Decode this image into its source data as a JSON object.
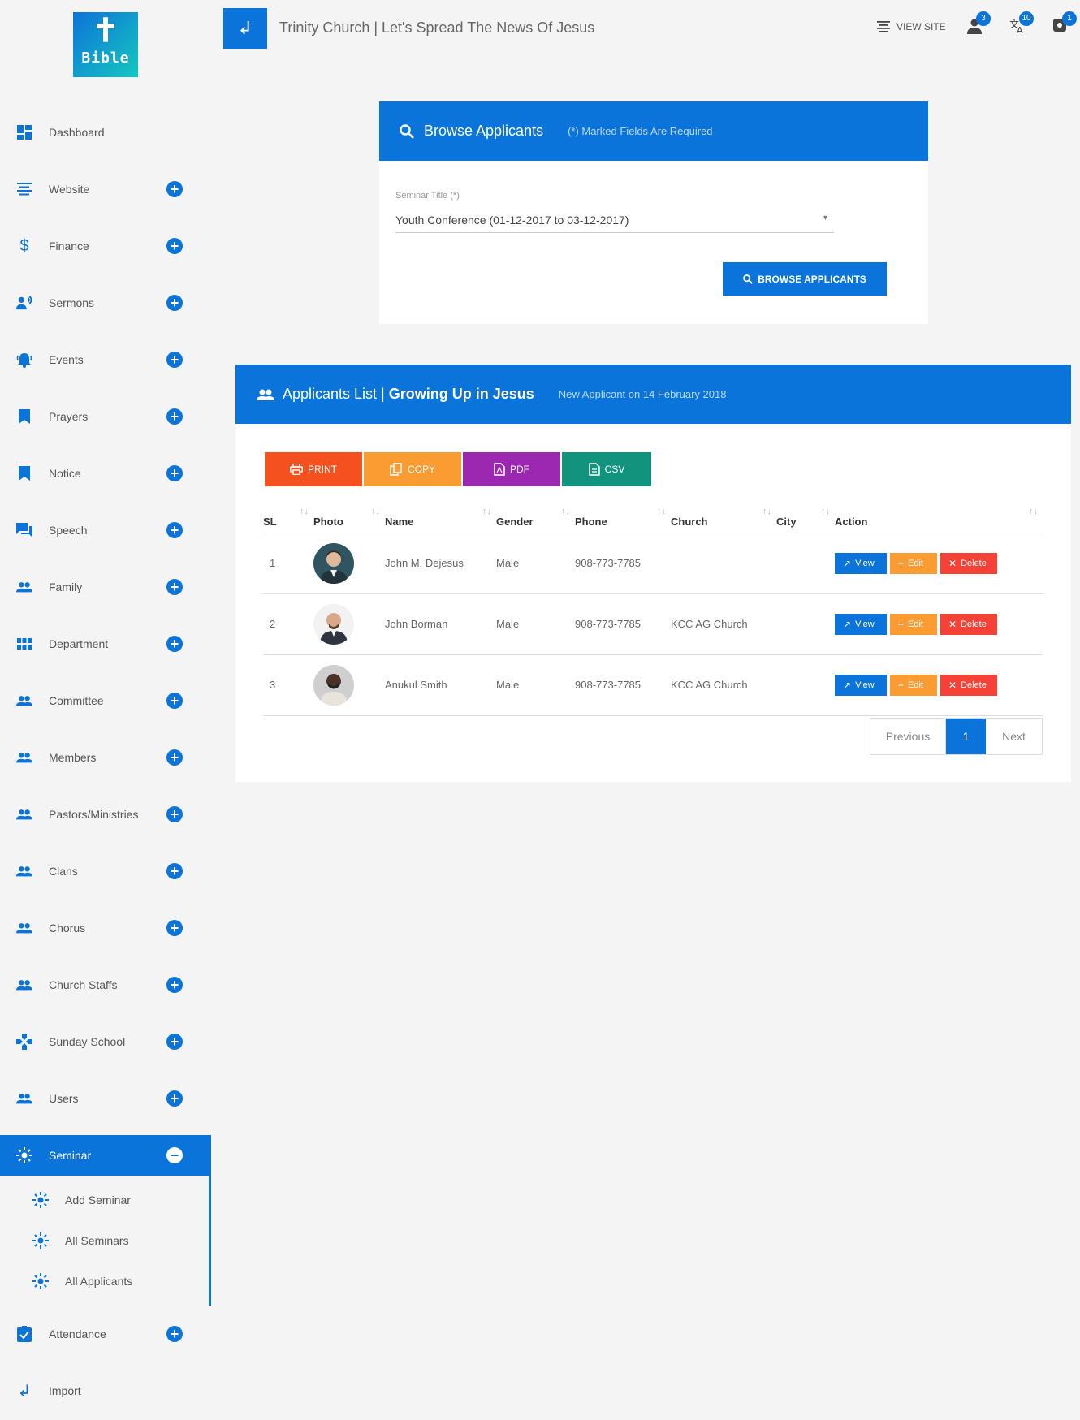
{
  "logo": {
    "text": "Bible"
  },
  "header": {
    "title": "Trinity Church | Let's Spread The News Of Jesus",
    "view_site": "VIEW SITE",
    "badges": {
      "users": "3",
      "translate": "10",
      "settings": "1"
    }
  },
  "sidebar": {
    "items": [
      {
        "label": "Dashboard",
        "icon": "dashboard-icon"
      },
      {
        "label": "Website",
        "icon": "website-icon"
      },
      {
        "label": "Finance",
        "icon": "dollar-icon"
      },
      {
        "label": "Sermons",
        "icon": "sermons-icon"
      },
      {
        "label": "Events",
        "icon": "bell-icon"
      },
      {
        "label": "Prayers",
        "icon": "bookmark-icon"
      },
      {
        "label": "Notice",
        "icon": "bookmark-icon"
      },
      {
        "label": "Speech",
        "icon": "chat-icon"
      },
      {
        "label": "Family",
        "icon": "people-icon"
      },
      {
        "label": "Department",
        "icon": "grid-icon"
      },
      {
        "label": "Committee",
        "icon": "people-icon"
      },
      {
        "label": "Members",
        "icon": "people-icon"
      },
      {
        "label": "Pastors/Ministries",
        "icon": "people-icon"
      },
      {
        "label": "Clans",
        "icon": "people-icon"
      },
      {
        "label": "Chorus",
        "icon": "people-icon"
      },
      {
        "label": "Church Staffs",
        "icon": "people-icon"
      },
      {
        "label": "Sunday School",
        "icon": "gamepad-icon"
      },
      {
        "label": "Users",
        "icon": "people-icon"
      }
    ],
    "active": {
      "label": "Seminar",
      "icon": "seminar-icon"
    },
    "sub_items": [
      {
        "label": "Add Seminar"
      },
      {
        "label": "All Seminars"
      },
      {
        "label": "All Applicants"
      }
    ],
    "after": [
      {
        "label": "Attendance",
        "icon": "clipboard-check-icon"
      },
      {
        "label": "Import",
        "icon": "import-icon"
      }
    ]
  },
  "browse": {
    "title": "Browse Applicants",
    "required_note": "(*) Marked Fields Are Required",
    "field_label": "Seminar Title (*)",
    "selected_value": "Youth Conference (01-12-2017 to 03-12-2017)",
    "button": "BROWSE APPLICANTS"
  },
  "list": {
    "title_prefix": "Applicants List | ",
    "title_bold": "Growing Up in Jesus",
    "subtitle": "New Applicant on 14 February 2018",
    "exports": {
      "print": "PRINT",
      "copy": "COPY",
      "pdf": "PDF",
      "csv": "CSV"
    },
    "columns": [
      "SL",
      "Photo",
      "Name",
      "Gender",
      "Phone",
      "Church",
      "City",
      "Action"
    ],
    "rows": [
      {
        "sl": "1",
        "name": "John M. Dejesus",
        "gender": "Male",
        "phone": "908-773-7785",
        "church": "",
        "city": ""
      },
      {
        "sl": "2",
        "name": "John Borman",
        "gender": "Male",
        "phone": "908-773-7785",
        "church": "KCC AG Church",
        "city": ""
      },
      {
        "sl": "3",
        "name": "Anukul Smith",
        "gender": "Male",
        "phone": "908-773-7785",
        "church": "KCC AG Church",
        "city": ""
      }
    ],
    "actions": {
      "view": "View",
      "edit": "Edit",
      "delete": "Delete"
    },
    "pager": {
      "prev": "Previous",
      "page": "1",
      "next": "Next"
    }
  },
  "colors": {
    "primary": "#0a74da",
    "print": "#f4511e",
    "copy": "#fb9c32",
    "pdf": "#9c27b0",
    "csv": "#12937e",
    "delete": "#f44336"
  }
}
